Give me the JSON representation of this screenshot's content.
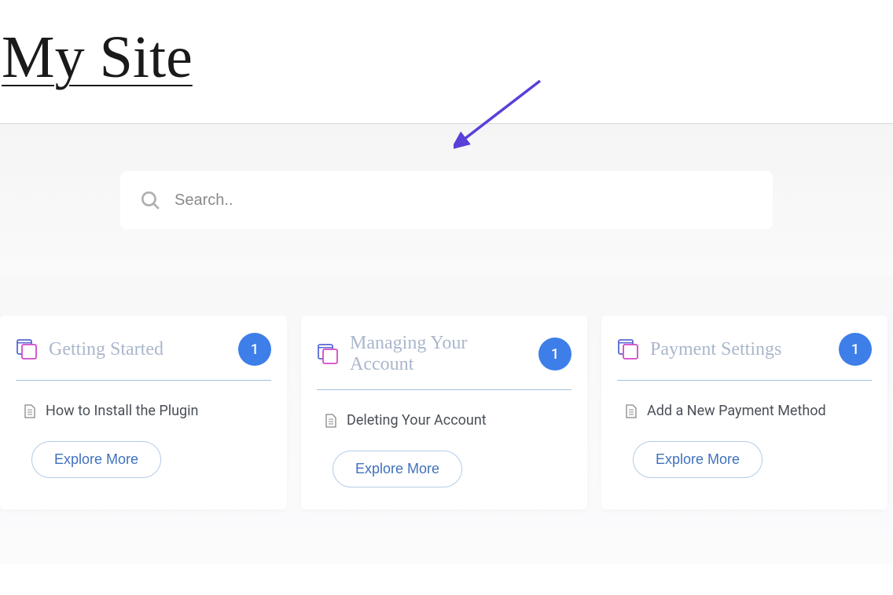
{
  "site": {
    "title": "My Site"
  },
  "search": {
    "placeholder": "Search.."
  },
  "cards": [
    {
      "title": "Getting Started",
      "count": "1",
      "article": "How to Install the Plugin",
      "button": "Explore More"
    },
    {
      "title": "Managing Your Account",
      "count": "1",
      "article": "Deleting Your Account",
      "button": "Explore More"
    },
    {
      "title": "Payment Settings",
      "count": "1",
      "article": "Add a New Payment Method",
      "button": "Explore More"
    }
  ]
}
